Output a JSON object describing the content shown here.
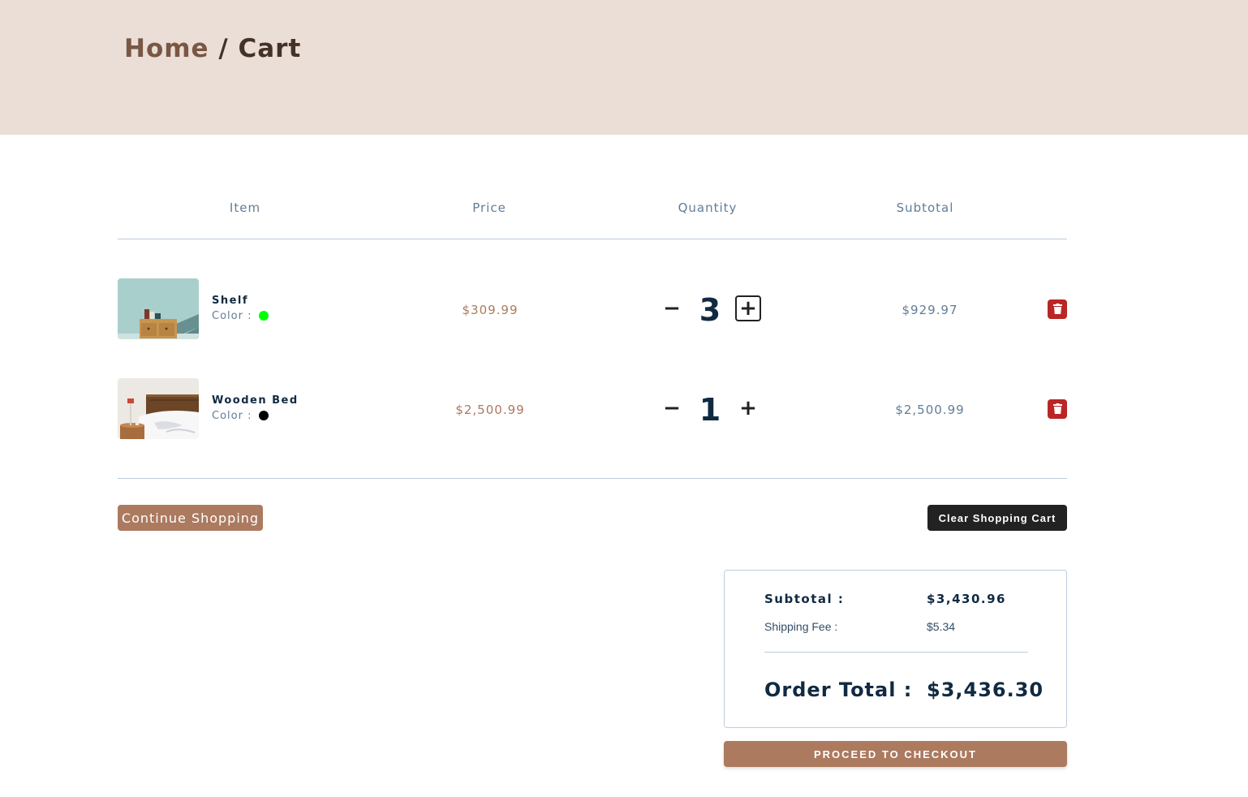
{
  "breadcrumb": {
    "home": "Home",
    "separator": " / ",
    "current": "Cart"
  },
  "columns": {
    "item": "Item",
    "price": "Price",
    "quantity": "Quantity",
    "subtotal": "Subtotal"
  },
  "items": [
    {
      "name": "Shelf",
      "color_label": "Color :",
      "color_hex": "#00ff00",
      "image": "shelf-photo",
      "price": "$309.99",
      "qty_minus": "−",
      "quantity": "3",
      "qty_plus": "+",
      "subtotal": "$929.97"
    },
    {
      "name": "Wooden Bed",
      "color_label": "Color :",
      "color_hex": "#000000",
      "image": "bed-photo",
      "price": "$2,500.99",
      "qty_minus": "−",
      "quantity": "1",
      "qty_plus": "+",
      "subtotal": "$2,500.99"
    }
  ],
  "buttons": {
    "continue_shopping": "Continue Shopping",
    "clear_cart": "Clear Shopping Cart",
    "checkout": "PROCEED TO CHECKOUT"
  },
  "totals": {
    "subtotal_label": "Subtotal :",
    "subtotal_value": "$3,430.96",
    "shipping_label": "Shipping Fee :",
    "shipping_value": "$5.34",
    "order_total_label": "Order Total :",
    "order_total_value": "$3,436.30"
  },
  "colors": {
    "hero_bg": "#eaded7",
    "accent": "#ab7a5f",
    "danger": "#bb2525",
    "dark": "#222222"
  }
}
